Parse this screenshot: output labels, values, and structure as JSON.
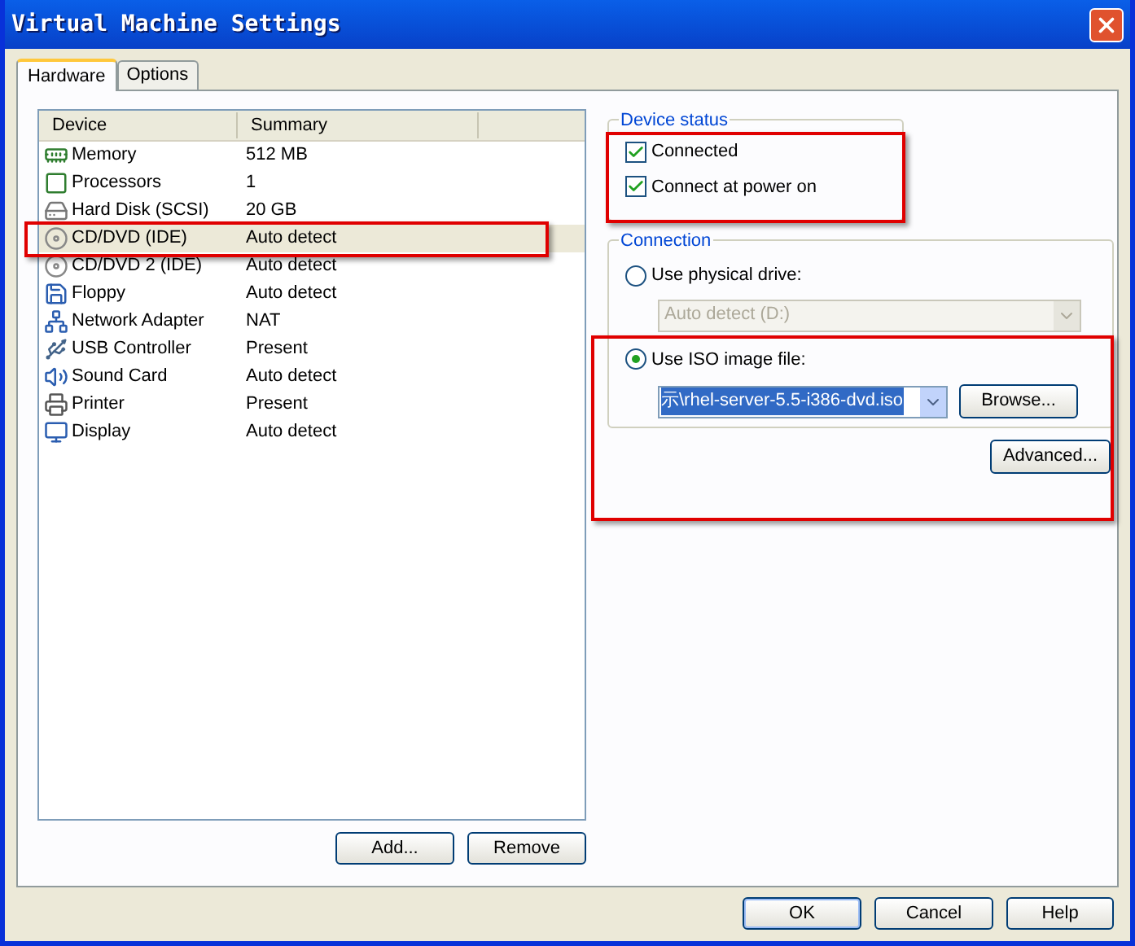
{
  "window": {
    "title": "Virtual Machine Settings"
  },
  "tabs": [
    {
      "label": "Hardware",
      "selected": true
    },
    {
      "label": "Options",
      "selected": false
    }
  ],
  "device_table": {
    "columns": [
      "Device",
      "Summary"
    ],
    "rows": [
      {
        "kind": "memory",
        "device": "Memory",
        "summary": "512 MB",
        "selected": false
      },
      {
        "kind": "processor",
        "device": "Processors",
        "summary": "1",
        "selected": false
      },
      {
        "kind": "disk",
        "device": "Hard Disk (SCSI)",
        "summary": "20 GB",
        "selected": false
      },
      {
        "kind": "cdrom",
        "device": "CD/DVD (IDE)",
        "summary": "Auto detect",
        "selected": true
      },
      {
        "kind": "cdrom",
        "device": "CD/DVD 2 (IDE)",
        "summary": "Auto detect",
        "selected": false
      },
      {
        "kind": "floppy",
        "device": "Floppy",
        "summary": "Auto detect",
        "selected": false
      },
      {
        "kind": "network",
        "device": "Network Adapter",
        "summary": "NAT",
        "selected": false
      },
      {
        "kind": "usb",
        "device": "USB Controller",
        "summary": "Present",
        "selected": false
      },
      {
        "kind": "sound",
        "device": "Sound Card",
        "summary": "Auto detect",
        "selected": false
      },
      {
        "kind": "printer",
        "device": "Printer",
        "summary": "Present",
        "selected": false
      },
      {
        "kind": "display",
        "device": "Display",
        "summary": "Auto detect",
        "selected": false
      }
    ]
  },
  "device_status": {
    "title": "Device status",
    "options": [
      {
        "label": "Connected",
        "checked": true
      },
      {
        "label": "Connect at power on",
        "checked": true
      }
    ]
  },
  "connection": {
    "title": "Connection",
    "physical": {
      "label": "Use physical drive:",
      "selected": false,
      "drive": "Auto detect (D:)",
      "disabled": true
    },
    "iso": {
      "label": "Use ISO image file:",
      "selected": true,
      "path": "示\\rhel-server-5.5-i386-dvd.iso",
      "browse": "Browse..."
    },
    "advanced": "Advanced..."
  },
  "list_buttons": [
    "Add...",
    "Remove"
  ],
  "dialog_buttons": [
    "OK",
    "Cancel",
    "Help"
  ]
}
